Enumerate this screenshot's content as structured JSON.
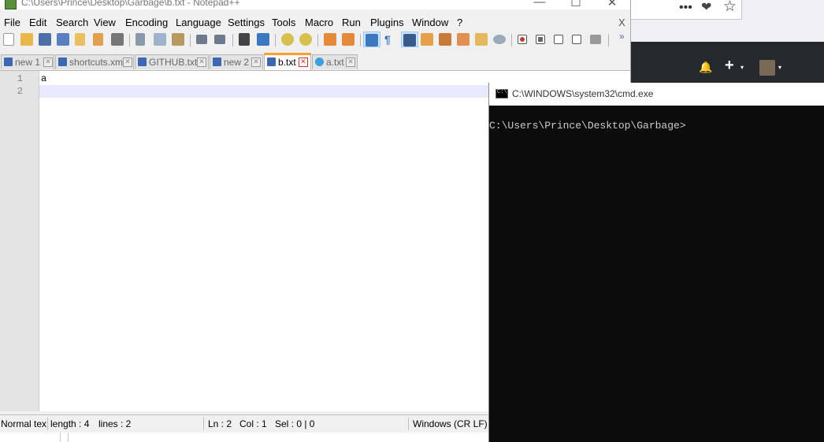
{
  "background": {
    "browser_icons": [
      "more-icon",
      "pocket-icon",
      "star-icon"
    ],
    "browser_glyphs": {
      "more": "•••",
      "pocket": "❤",
      "star": "☆"
    },
    "github_icons": [
      "bell-icon",
      "plus-icon",
      "avatar"
    ],
    "github_glyphs": {
      "bell": "🔔",
      "plus": "+",
      "caret": "▾"
    }
  },
  "npp": {
    "title": "C:\\Users\\Prince\\Desktop\\Garbage\\b.txt - Notepad++",
    "window_buttons": {
      "minimize": "—",
      "maximize": "☐",
      "close": "✕"
    },
    "menu": [
      "File",
      "Edit",
      "Search",
      "View",
      "Encoding",
      "Language",
      "Settings",
      "Tools",
      "Macro",
      "Run",
      "Plugins",
      "Window",
      "?"
    ],
    "menu_close": "X",
    "toolbar_more": "»",
    "tabs": [
      {
        "label": "new 1",
        "icon": "save-icon",
        "active": false
      },
      {
        "label": "shortcuts.xml",
        "icon": "save-icon",
        "active": false
      },
      {
        "label": "GITHUB.txt",
        "icon": "save-icon",
        "active": false
      },
      {
        "label": "new 2",
        "icon": "save-icon",
        "active": false
      },
      {
        "label": "b.txt",
        "icon": "save-icon",
        "active": true
      },
      {
        "label": "a.txt",
        "icon": "monitor-eye-icon",
        "active": false
      }
    ],
    "tab_close": "✕",
    "editor": {
      "line_numbers": [
        "1",
        "2"
      ],
      "lines": [
        "a",
        ""
      ]
    },
    "status": {
      "type": "Normal tex",
      "length": "length : 4",
      "lines": "lines : 2",
      "ln": "Ln : 2",
      "col": "Col : 1",
      "sel": "Sel : 0 | 0",
      "eol": "Windows (CR LF)"
    }
  },
  "cmd": {
    "title": "C:\\WINDOWS\\system32\\cmd.exe",
    "prompt": "C:\\Users\\Prince\\Desktop\\Garbage>"
  },
  "colors": {
    "tab_active_accent": "#fa9d2f",
    "current_line": "#e8e8ff",
    "cmd_bg": "#0c0c0c",
    "github_header": "#24292e"
  }
}
